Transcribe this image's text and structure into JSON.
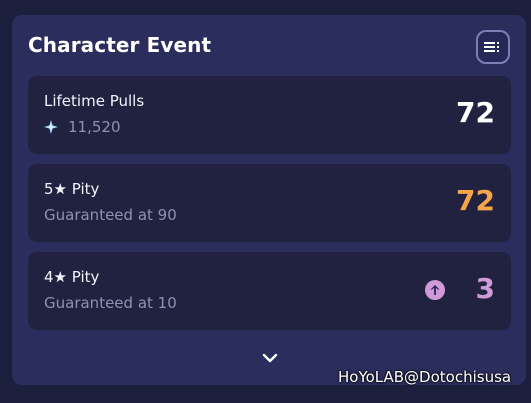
{
  "header": {
    "title": "Character Event"
  },
  "cards": [
    {
      "label": "Lifetime Pulls",
      "sub": "11,520",
      "value": "72",
      "value_color": "#ffffff",
      "sub_icon": "primogem-star-icon"
    },
    {
      "label": "5★ Pity",
      "sub": "Guaranteed at 90",
      "value": "72",
      "value_color": "#f5a54a"
    },
    {
      "label": "4★ Pity",
      "sub": "Guaranteed at 10",
      "value": "3",
      "value_color": "#d09ad8",
      "status_icon": "arrow-up-circle-icon"
    }
  ],
  "footer": {
    "expand_icon": "chevron-down-icon"
  },
  "watermark": "HoYoLAB@Dotochisusa"
}
